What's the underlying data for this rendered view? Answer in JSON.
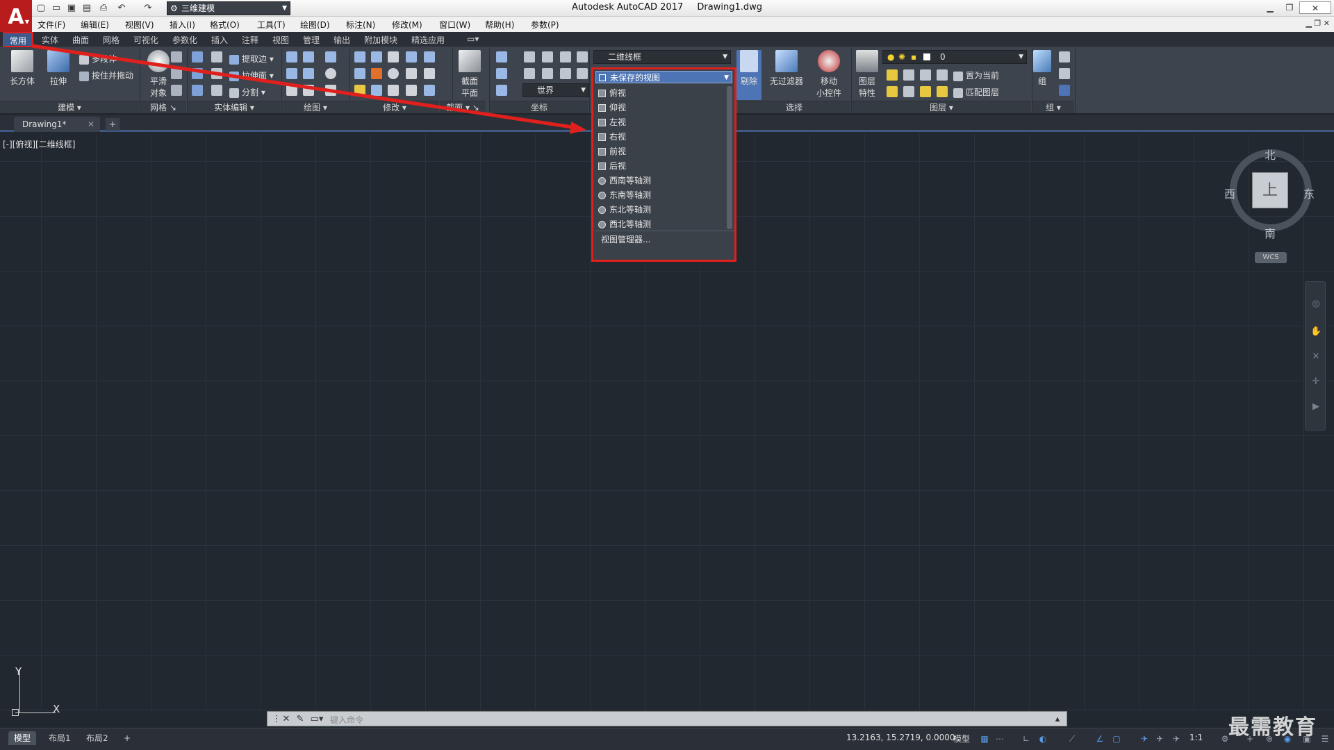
{
  "app": {
    "title": "Autodesk AutoCAD 2017",
    "file": "Drawing1.dwg",
    "logo": "A",
    "workspace": "三维建模"
  },
  "menu": [
    "文件(F)",
    "编辑(E)",
    "视图(V)",
    "插入(I)",
    "格式(O)",
    "工具(T)",
    "绘图(D)",
    "标注(N)",
    "修改(M)",
    "窗口(W)",
    "帮助(H)",
    "参数(P)"
  ],
  "ribbon_tabs": [
    "常用",
    "实体",
    "曲面",
    "网格",
    "可视化",
    "参数化",
    "插入",
    "注释",
    "视图",
    "管理",
    "输出",
    "附加模块",
    "精选应用"
  ],
  "ribbon": {
    "modeling": {
      "title": "建模",
      "box": "长方体",
      "extrude": "拉伸",
      "polysolid": "多段体",
      "presspull": "按住并拖动"
    },
    "mesh": {
      "title": "网格",
      "smooth": "平滑\n对象"
    },
    "solid_edit": {
      "title": "实体编辑",
      "extract_edges": "提取边",
      "extrude_faces": "拉伸面",
      "separate": "分割"
    },
    "draw": {
      "title": "绘图"
    },
    "modify": {
      "title": "修改"
    },
    "section": {
      "title": "截面",
      "plane": "截面\n平面"
    },
    "coords": {
      "title": "坐标",
      "world": "世界"
    },
    "view": {
      "visual_style": "二维线框",
      "saved_view": "未保存的视图"
    },
    "select": {
      "title": "选择",
      "cull": "剔除",
      "no_filter": "无过滤器",
      "gizmo": "移动\n小控件"
    },
    "layers": {
      "title": "图层",
      "properties": "图层\n特性",
      "layer_name": "0",
      "set_current": "置为当前",
      "match": "匹配图层"
    },
    "group": {
      "title": "组",
      "group": "组"
    }
  },
  "view_dropdown": {
    "items": [
      "俯视",
      "仰视",
      "左视",
      "右视",
      "前视",
      "后视",
      "西南等轴测",
      "东南等轴测",
      "东北等轴测",
      "西北等轴测"
    ],
    "manager": "视图管理器..."
  },
  "doc_tab": "Drawing1*",
  "viewport_label": "[-][俯视][二维线框]",
  "viewcube": {
    "top": "上",
    "north": "北",
    "south": "南",
    "east": "东",
    "west": "西",
    "wcs": "WCS"
  },
  "ucs": {
    "x": "X",
    "y": "Y"
  },
  "command": {
    "placeholder": "键入命令"
  },
  "layout_tabs": [
    "模型",
    "布局1",
    "布局2"
  ],
  "status": {
    "coords": "13.2163, 15.2719, 0.0000",
    "model": "模型",
    "scale": "1:1"
  },
  "watermark": "最需教育"
}
